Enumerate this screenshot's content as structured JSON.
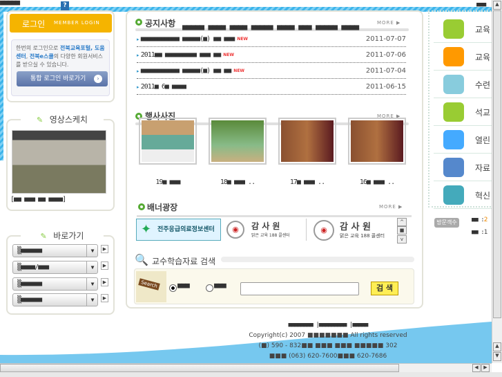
{
  "top": {
    "tofu": "■■■■■",
    "help": "?",
    "right_tofu": "■■■"
  },
  "login": {
    "title": "로그인",
    "subtitle": "MEMBER LOGIN",
    "desc_pre": "한번의 로그인으로 ",
    "desc_link1": "전북교육포털, 도움센터",
    "desc_mid": ", ",
    "desc_link2": "전북e스쿨",
    "desc_post": "의 다양한 회원서비스를 받으실 수 있습니다.",
    "button": "통합 로그인 바로가기"
  },
  "video": {
    "title": "영상스케치",
    "caption": "[■■ ■■■ ■■ ■■■■]"
  },
  "shortcut": {
    "title": "바로가기",
    "selects": [
      "▒■■■■■■",
      "▒■■■■/■■■",
      "▒■■■■■■",
      "▒■■■■■■"
    ],
    "go": "▶"
  },
  "notice": {
    "title": "공지사항",
    "more": "MORE ▶",
    "overlay": "■■■■■ ■■■■ ■■■■ ■■■■■ ■■■■ ■■■ ■■■■■ ■■■■",
    "new_label": "NEW",
    "items": [
      {
        "text": "■■■■■■■■■■■ ■■■■■(■) ■■ ■■■",
        "date": "2011-07-07",
        "new": true
      },
      {
        "text": "2011■■ ■■■■■■■■■ ■■■ ■■",
        "date": "2011-07-06",
        "new": true
      },
      {
        "text": "■■■■■■■■■■■ ■■■■■(■) ■■ ■■",
        "date": "2011-07-04",
        "new": true
      },
      {
        "text": "2011■ 6■ ■■■■",
        "date": "2011-06-15",
        "new": false
      }
    ]
  },
  "photos": {
    "title": "행사사진",
    "more": "MORE ▶",
    "items": [
      {
        "caption": "19■ ■■■"
      },
      {
        "caption": "18■ ■■■ .."
      },
      {
        "caption": "17■ ■■■ .."
      },
      {
        "caption": "16■ ■■■ .."
      }
    ]
  },
  "banner": {
    "title": "배너광장",
    "more": "MORE ▶",
    "items": [
      {
        "name": "전주응급의료정보센터"
      },
      {
        "name": "감 사 원",
        "sub": "맑은 교육 188 콜센터"
      },
      {
        "name": "감 사 원",
        "sub": "맑은 교육 188 콜센터"
      }
    ],
    "up": "^",
    "stop": "■",
    "down": "v"
  },
  "search": {
    "title": "교수학습자료 검색",
    "sign": "Search",
    "radio1": "■■■",
    "radio2": "■■■",
    "input_value": "",
    "button": "검 색"
  },
  "right_menu": {
    "items": [
      "교육",
      "교육",
      "수련",
      "석교",
      "열린",
      "자료",
      "혁신"
    ],
    "colors": [
      "#9c3",
      "#f90",
      "#8cd",
      "#9c3",
      "#4af",
      "#58c",
      "#4ab"
    ]
  },
  "visitors": {
    "badge": "방문객수",
    "rows": [
      {
        "label": "■■ :",
        "value": "2"
      },
      {
        "label": "■■ :",
        "value": "1"
      }
    ]
  },
  "footer": {
    "links": "■■■■■■■■ |■■■■■■■■■ |■■■■■",
    "copyright": "Copyright(c) 2007 ■■■■■■■ All rights reserved",
    "address": "(■) 590 - 832■■ ■■■ ■■■ ■■■■■ 302",
    "phone": "■■■ (063) 620-7600■■■ 620-7686"
  }
}
